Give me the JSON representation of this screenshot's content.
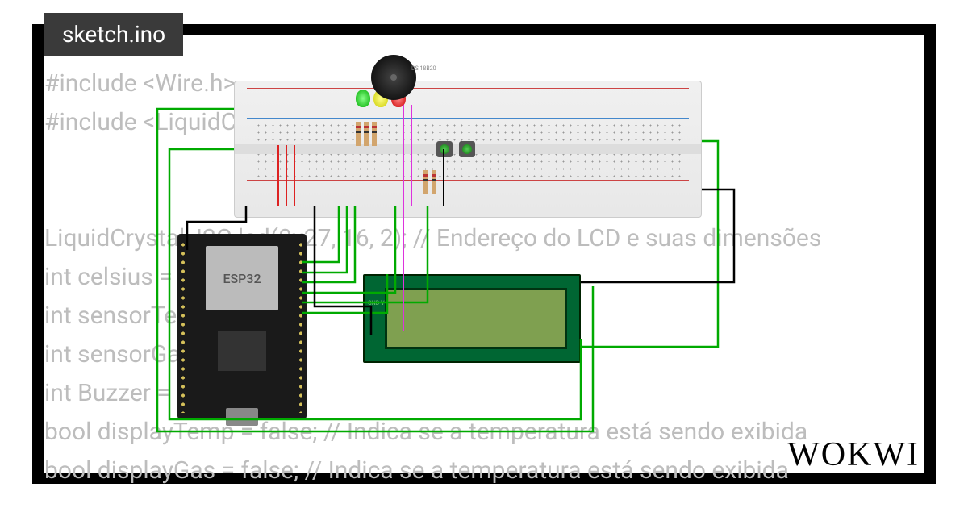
{
  "tab": {
    "filename": "sketch.ino"
  },
  "code_lines": [
    "#include <Wire.h>",
    "#include <LiquidCrystal_I2C.h>",
    "",
    "",
    "LiquidCrystal_I2C lcd(0x27, 16, 2); // Endereço do LCD e suas dimensões",
    "int celsius = 0;",
    "int sensorTemp = A0;",
    "int sensorGas = A1;",
    "int Buzzer = 6;",
    "bool displayTemp = false; // Indica se a temperatura está sendo exibida",
    "bool displayGas = false; // Indica se a temperatura está sendo exibida"
  ],
  "components": {
    "mcu": "ESP32",
    "sensor_label": "DS\n18B20",
    "lcd_pins": "GND\nVCC\nSDA\nSCL"
  },
  "brand": "WOKWI"
}
